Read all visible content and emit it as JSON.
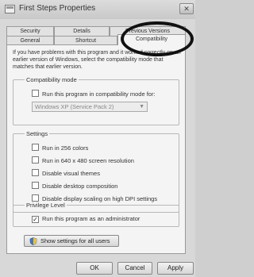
{
  "window": {
    "title": "First Steps Properties",
    "close_glyph": "✕"
  },
  "tabs": {
    "row1": [
      "Security",
      "Details",
      "Previous Versions"
    ],
    "row2": [
      "General",
      "Shortcut",
      "Compatibility"
    ],
    "selected": "Compatibility"
  },
  "intro": "If you have problems with this program and it worked correctly on an earlier version of Windows, select the compatibility mode that matches that earlier version.",
  "compat_mode": {
    "label": "Compatibility mode",
    "checkbox": {
      "label": "Run this program in compatibility mode for:",
      "checked": false
    },
    "select_value": "Windows XP (Service Pack 2)"
  },
  "settings": {
    "label": "Settings",
    "items": [
      {
        "label": "Run in 256 colors",
        "checked": false
      },
      {
        "label": "Run in 640 x 480 screen resolution",
        "checked": false
      },
      {
        "label": "Disable visual themes",
        "checked": false
      },
      {
        "label": "Disable desktop composition",
        "checked": false
      },
      {
        "label": "Disable display scaling on high DPI settings",
        "checked": false
      }
    ]
  },
  "privilege": {
    "label": "Privilege Level",
    "checkbox": {
      "label": "Run this program as an administrator",
      "checked": true,
      "mark": "✓"
    }
  },
  "show_settings_button": "Show settings for all users",
  "buttons": {
    "ok": "OK",
    "cancel": "Cancel",
    "apply": "Apply"
  },
  "colors": {
    "highlight_ellipse": "#111111"
  }
}
